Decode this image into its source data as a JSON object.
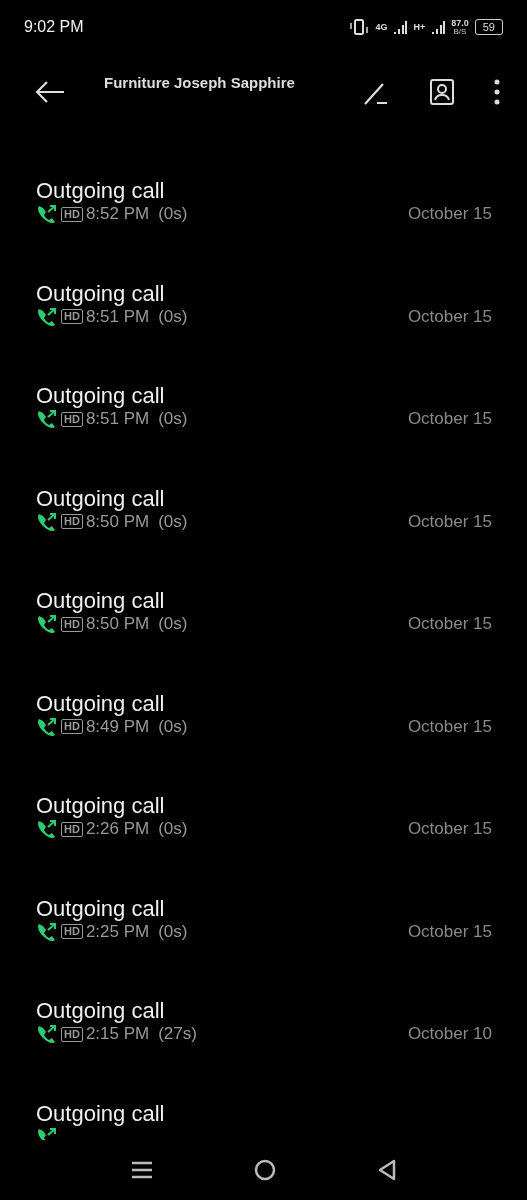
{
  "status_bar": {
    "time": "9:02 PM",
    "network_1": "4G",
    "network_2": "H+",
    "speed": "87.0",
    "speed_unit": "B/S",
    "battery": "59"
  },
  "header": {
    "title": "Furniture Joseph Sapphire"
  },
  "calls": [
    {
      "title": "Outgoing call",
      "kind": "outgoing",
      "badge": "HD",
      "time": "8:52 PM",
      "duration": "(0s)",
      "date": "October 15"
    },
    {
      "title": "Outgoing call",
      "kind": "outgoing",
      "badge": "HD",
      "time": "8:51 PM",
      "duration": "(0s)",
      "date": "October 15"
    },
    {
      "title": "Outgoing call",
      "kind": "outgoing",
      "badge": "HD",
      "time": "8:51 PM",
      "duration": "(0s)",
      "date": "October 15"
    },
    {
      "title": "Outgoing call",
      "kind": "outgoing",
      "badge": "HD",
      "time": "8:50 PM",
      "duration": "(0s)",
      "date": "October 15"
    },
    {
      "title": "Outgoing call",
      "kind": "outgoing",
      "badge": "HD",
      "time": "8:50 PM",
      "duration": "(0s)",
      "date": "October 15"
    },
    {
      "title": "Outgoing call",
      "kind": "outgoing",
      "badge": "HD",
      "time": "8:49 PM",
      "duration": "(0s)",
      "date": "October 15"
    },
    {
      "title": "Outgoing call",
      "kind": "outgoing",
      "badge": "HD",
      "time": "2:26 PM",
      "duration": "(0s)",
      "date": "October 15"
    },
    {
      "title": "Outgoing call",
      "kind": "outgoing",
      "badge": "HD",
      "time": "2:25 PM",
      "duration": "(0s)",
      "date": "October 15"
    },
    {
      "title": "Outgoing call",
      "kind": "outgoing",
      "badge": "HD",
      "time": "2:15 PM",
      "duration": "(27s)",
      "date": "October 10"
    },
    {
      "title": "Outgoing call",
      "kind": "outgoing"
    }
  ]
}
